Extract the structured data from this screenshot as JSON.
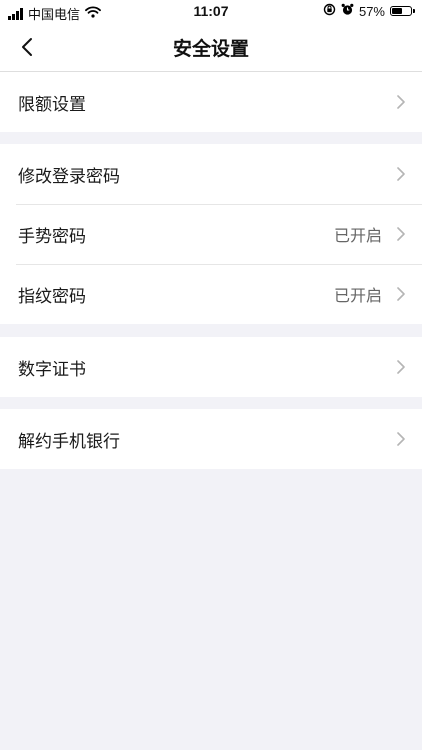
{
  "status_bar": {
    "carrier": "中国电信",
    "time": "11:07",
    "battery_percent": "57%",
    "battery_level": 0.57,
    "icons": [
      "signal-icon",
      "wifi-icon",
      "rotation-lock-icon",
      "alarm-icon",
      "battery-icon"
    ]
  },
  "nav": {
    "title": "安全设置",
    "back_icon": "chevron-left-icon"
  },
  "groups": [
    {
      "items": [
        {
          "label": "限额设置",
          "value": ""
        }
      ]
    },
    {
      "items": [
        {
          "label": "修改登录密码",
          "value": ""
        },
        {
          "label": "手势密码",
          "value": "已开启"
        },
        {
          "label": "指纹密码",
          "value": "已开启"
        }
      ]
    },
    {
      "items": [
        {
          "label": "数字证书",
          "value": ""
        }
      ]
    },
    {
      "items": [
        {
          "label": "解约手机银行",
          "value": ""
        }
      ]
    }
  ],
  "colors": {
    "background": "#f2f2f7",
    "card": "#ffffff",
    "chevron": "#b5b5b5"
  }
}
